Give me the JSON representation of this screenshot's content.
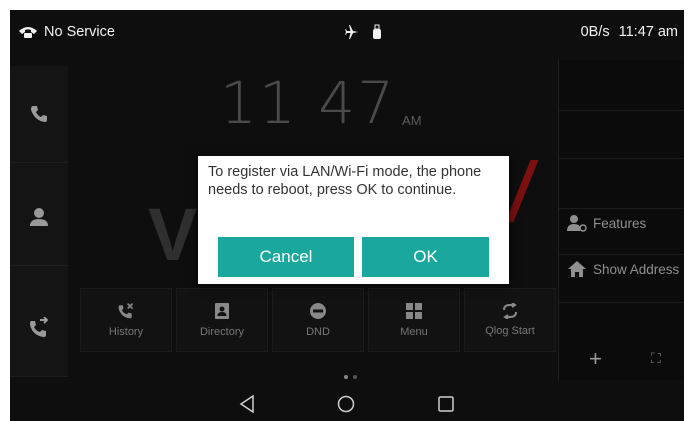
{
  "statusbar": {
    "service_text": "No Service",
    "network_speed": "0B/s",
    "time": "11:47 am",
    "icons": [
      "phone-handset-icon",
      "airplane-icon",
      "usb-icon"
    ]
  },
  "clock": {
    "time": "11 47",
    "ampm": "AM"
  },
  "logo": {
    "letter": "V"
  },
  "left_nav": [
    {
      "icon": "phone-icon"
    },
    {
      "icon": "contact-icon"
    },
    {
      "icon": "call-forward-icon"
    }
  ],
  "right_panel": {
    "features_label": "Features",
    "show_address_label": "Show Address",
    "add_icon": "+",
    "expand_icon": "⛶"
  },
  "dock": [
    {
      "label": "History",
      "icon": "history-icon"
    },
    {
      "label": "Directory",
      "icon": "directory-icon"
    },
    {
      "label": "DND",
      "icon": "dnd-icon"
    },
    {
      "label": "Menu",
      "icon": "menu-grid-icon"
    },
    {
      "label": "Qlog Start",
      "icon": "qlog-icon"
    }
  ],
  "dialog": {
    "message": "To register via LAN/Wi-Fi mode, the phone needs to reboot, press OK to continue.",
    "cancel_label": "Cancel",
    "ok_label": "OK",
    "accent_color": "#1aa79e"
  },
  "navbar": {
    "buttons": [
      "back",
      "home",
      "recents"
    ]
  }
}
